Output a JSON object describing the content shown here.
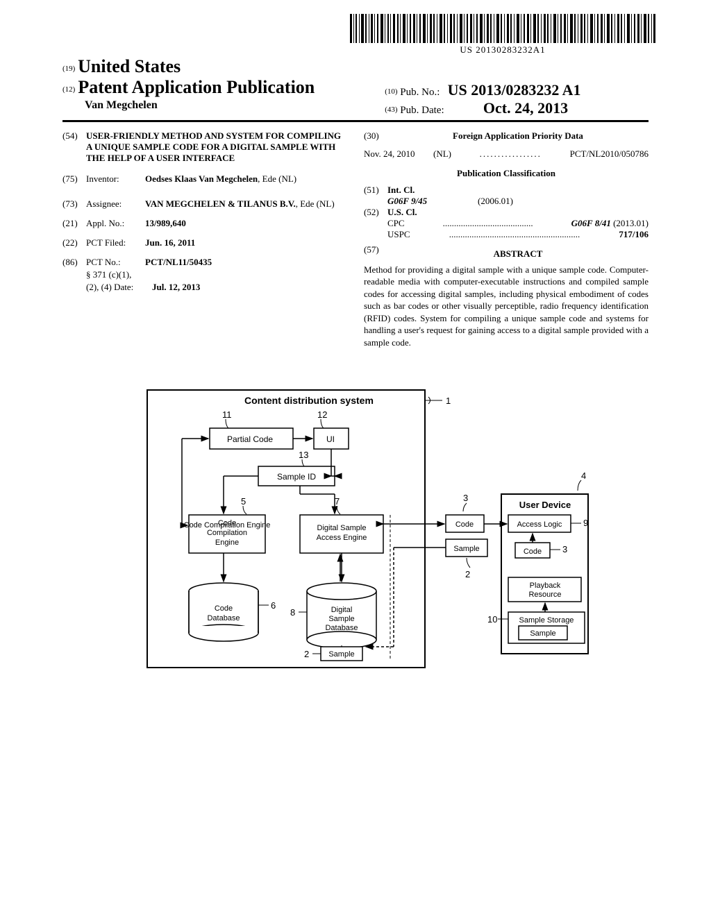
{
  "barcode_text": "US 20130283232A1",
  "header": {
    "inid_country": "(19)",
    "country": "United States",
    "inid_pubtype": "(12)",
    "pubtype": "Patent Application Publication",
    "inventor_header": "Van Megchelen",
    "inid_pubno": "(10)",
    "pubno_label": "Pub. No.:",
    "pubno": "US 2013/0283232 A1",
    "inid_pubdate": "(43)",
    "pubdate_label": "Pub. Date:",
    "pubdate": "Oct. 24, 2013"
  },
  "left": {
    "inid_title": "(54)",
    "title": "USER-FRIENDLY METHOD AND SYSTEM FOR COMPILING A UNIQUE SAMPLE CODE FOR A DIGITAL SAMPLE WITH THE HELP OF A USER INTERFACE",
    "inid_inventor": "(75)",
    "inventor_label": "Inventor:",
    "inventor_value": "Oedses Klaas Van Megchelen",
    "inventor_loc": ", Ede (NL)",
    "inid_assignee": "(73)",
    "assignee_label": "Assignee:",
    "assignee_value": "VAN MEGCHELEN & TILANUS B.V.",
    "assignee_loc": ", Ede (NL)",
    "inid_applno": "(21)",
    "applno_label": "Appl. No.:",
    "applno": "13/989,640",
    "inid_pctfiled": "(22)",
    "pctfiled_label": "PCT Filed:",
    "pctfiled": "Jun. 16, 2011",
    "inid_pctno": "(86)",
    "pctno_label": "PCT No.:",
    "pctno": "PCT/NL11/50435",
    "s371_label": "§ 371 (c)(1),",
    "s371_dates_label": "(2), (4) Date:",
    "s371_date": "Jul. 12, 2013"
  },
  "right": {
    "inid_foreign": "(30)",
    "foreign_title": "Foreign Application Priority Data",
    "foreign_date": "Nov. 24, 2010",
    "foreign_country": "(NL)",
    "foreign_dots": ".................",
    "foreign_app": "PCT/NL2010/050786",
    "class_title": "Publication Classification",
    "inid_intcl": "(51)",
    "intcl_label": "Int. Cl.",
    "intcl_sym": "G06F 9/45",
    "intcl_ver": "(2006.01)",
    "inid_uscl": "(52)",
    "uscl_label": "U.S. Cl.",
    "cpc_label": "CPC",
    "cpc_dots": "........................................",
    "cpc_val": "G06F 8/41",
    "cpc_ver": "(2013.01)",
    "uspc_label": "USPC",
    "uspc_dots": "..........................................................",
    "uspc_val": "717/106",
    "inid_abstract": "(57)",
    "abstract_title": "ABSTRACT",
    "abstract": "Method for providing a digital sample with a unique sample code. Computer-readable media with computer-executable instructions and compiled sample codes for accessing digital samples, including physical embodiment of codes such as bar codes or other visually perceptible, radio frequency identification (RFID) codes. System for compiling a unique sample code and systems for handling a user's request for gaining access to a digital sample provided with a sample code."
  },
  "figure": {
    "title": "Content distribution system",
    "b1": "1",
    "b11": "11",
    "b12": "12",
    "b13": "13",
    "b5": "5",
    "b7": "7",
    "b6": "6",
    "b8": "8",
    "b2a": "2",
    "b2b": "2",
    "b3a": "3",
    "b3b": "3",
    "b4": "4",
    "b9": "9",
    "b10": "10",
    "partial_code": "Partial Code",
    "ui": "UI",
    "sample_id": "Sample ID",
    "code_comp": "Code Compilation Engine",
    "access_engine": "Digital Sample Access Engine",
    "code_db": "Code Database",
    "digital_db": "Digital Sample Database",
    "sample": "Sample",
    "code": "Code",
    "user_device": "User Device",
    "access_logic": "Access Logic",
    "playback": "Playback Resource",
    "storage": "Sample Storage"
  }
}
